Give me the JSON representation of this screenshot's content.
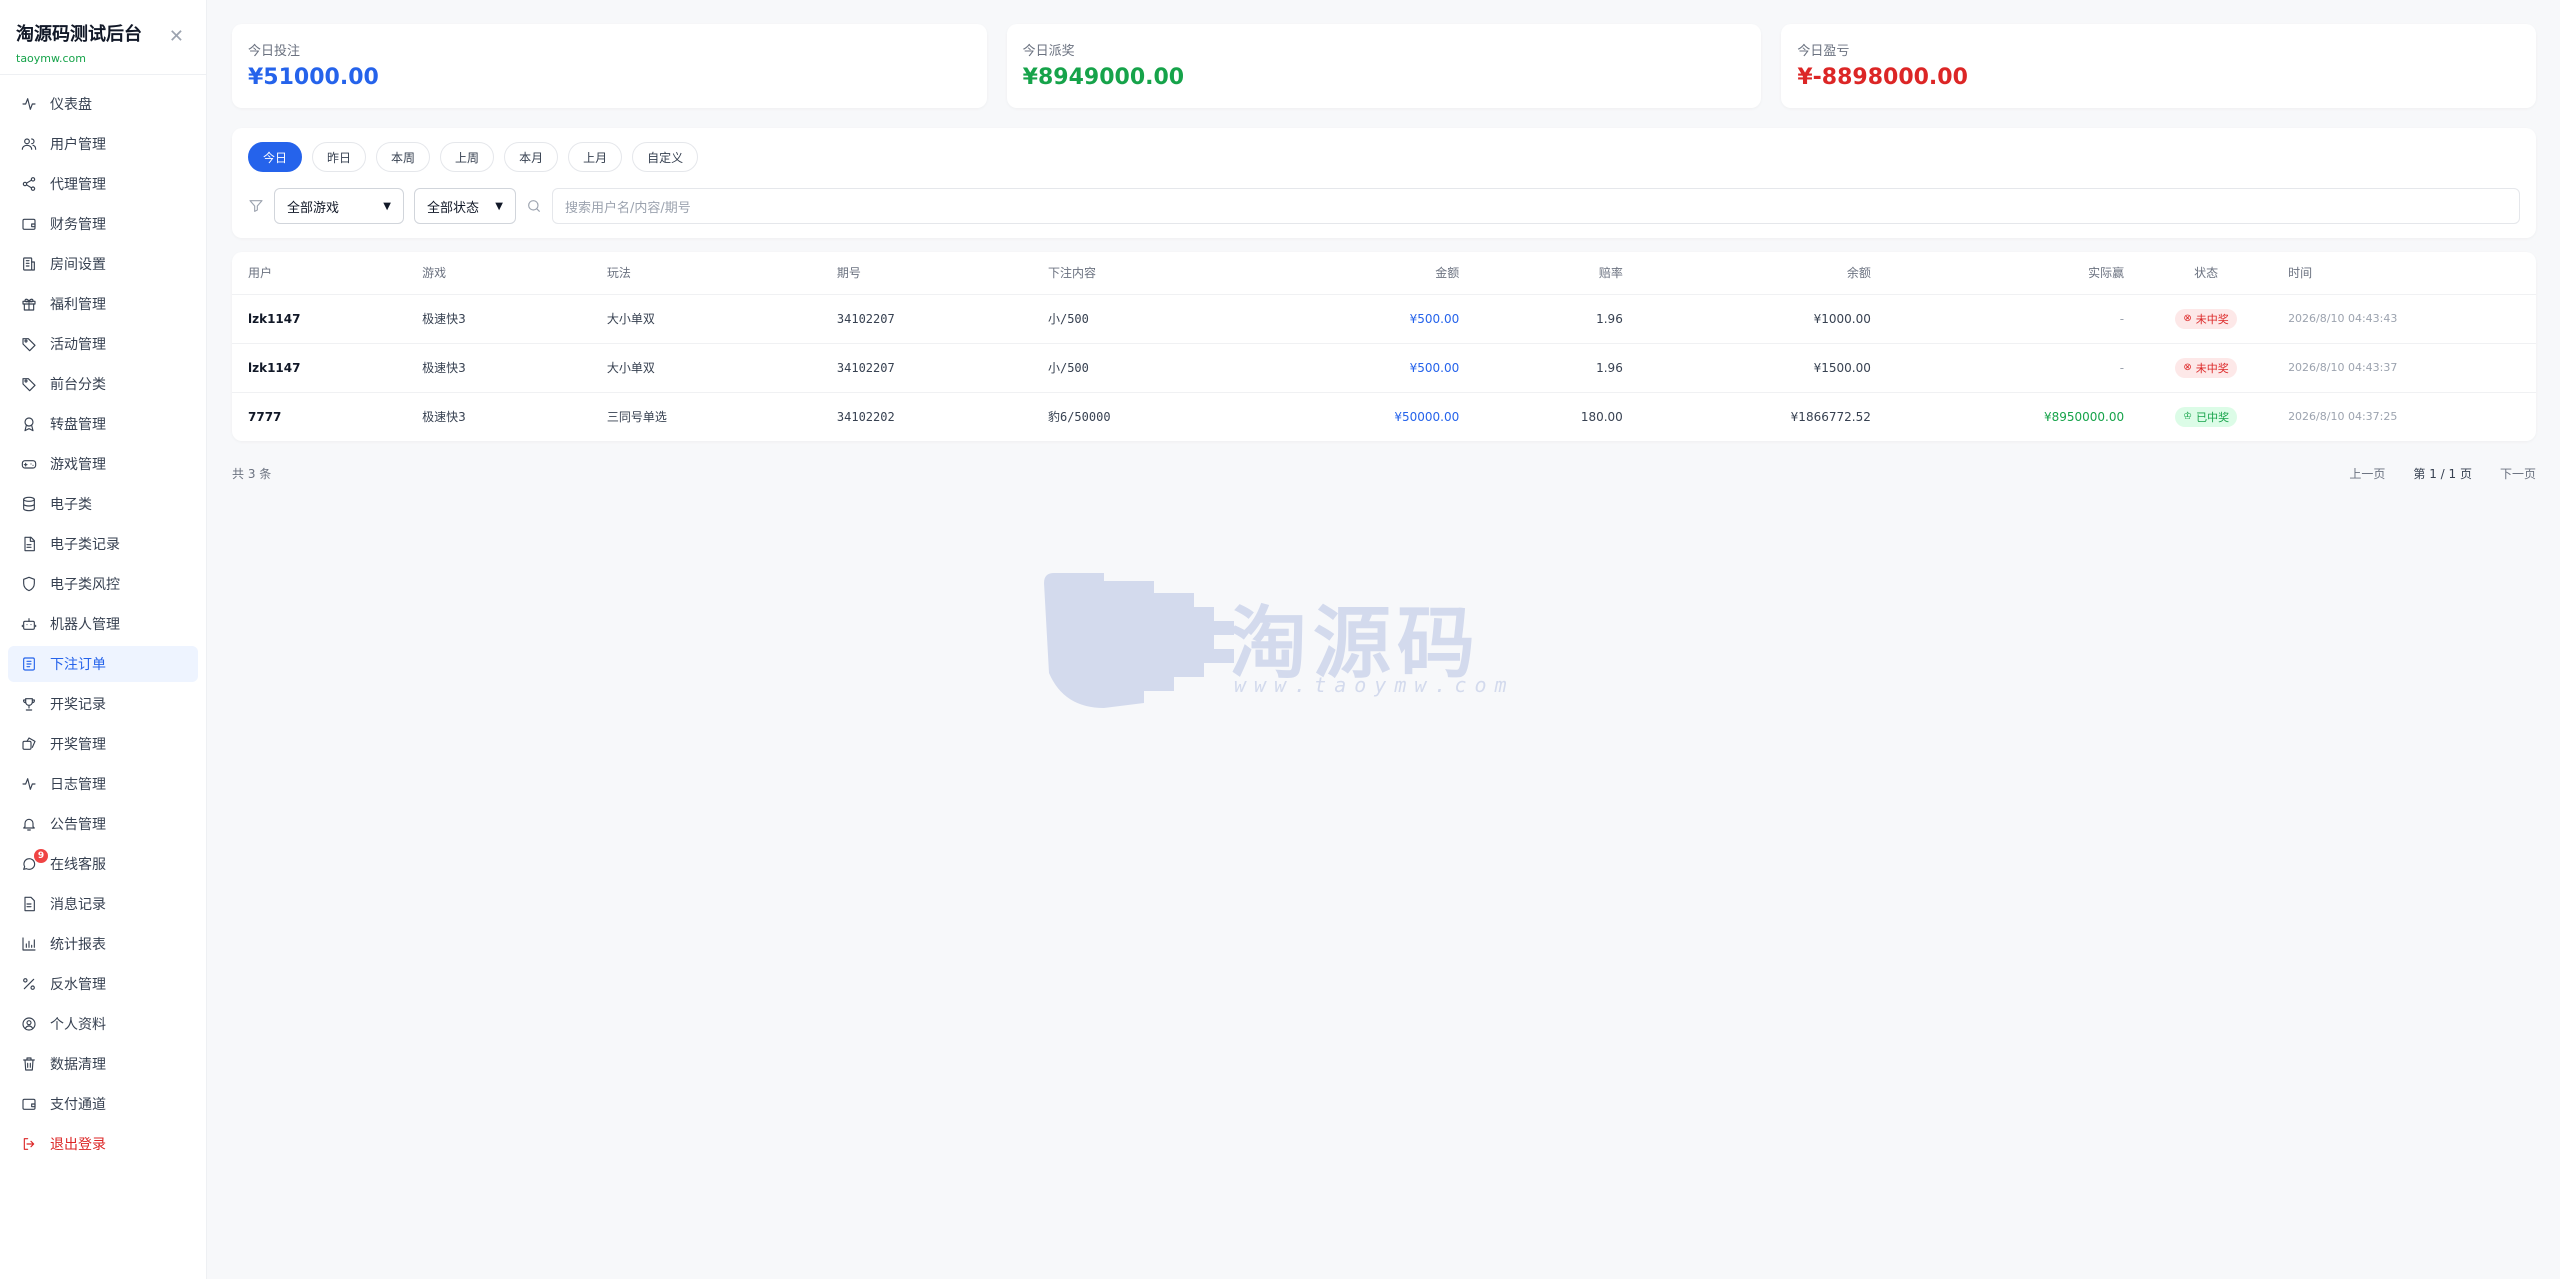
{
  "brand": {
    "title": "淘源码测试后台",
    "subtitle": "taoymw.com"
  },
  "nav": [
    {
      "label": "仪表盘",
      "icon": "activity-icon"
    },
    {
      "label": "用户管理",
      "icon": "users-icon"
    },
    {
      "label": "代理管理",
      "icon": "share-icon"
    },
    {
      "label": "财务管理",
      "icon": "wallet-icon"
    },
    {
      "label": "房间设置",
      "icon": "building-icon"
    },
    {
      "label": "福利管理",
      "icon": "gift-icon"
    },
    {
      "label": "活动管理",
      "icon": "tag-icon"
    },
    {
      "label": "前台分类",
      "icon": "tags-icon"
    },
    {
      "label": "转盘管理",
      "icon": "award-icon"
    },
    {
      "label": "游戏管理",
      "icon": "gamepad-icon"
    },
    {
      "label": "电子类",
      "icon": "database-icon"
    },
    {
      "label": "电子类记录",
      "icon": "file-icon"
    },
    {
      "label": "电子类风控",
      "icon": "shield-icon"
    },
    {
      "label": "机器人管理",
      "icon": "bot-icon"
    },
    {
      "label": "下注订单",
      "icon": "receipt-icon",
      "active": true
    },
    {
      "label": "开奖记录",
      "icon": "trophy-icon"
    },
    {
      "label": "开奖管理",
      "icon": "dice-icon"
    },
    {
      "label": "日志管理",
      "icon": "pulse-icon"
    },
    {
      "label": "公告管理",
      "icon": "bell-icon"
    },
    {
      "label": "在线客服",
      "icon": "chat-icon",
      "badge": "9"
    },
    {
      "label": "消息记录",
      "icon": "message-icon"
    },
    {
      "label": "统计报表",
      "icon": "chart-icon"
    },
    {
      "label": "反水管理",
      "icon": "percent-icon"
    },
    {
      "label": "个人资料",
      "icon": "user-circle-icon"
    },
    {
      "label": "数据清理",
      "icon": "trash-icon"
    },
    {
      "label": "支付通道",
      "icon": "card-icon"
    },
    {
      "label": "退出登录",
      "icon": "logout-icon",
      "logout": true
    }
  ],
  "stats": [
    {
      "label": "今日投注",
      "value": "¥51000.00",
      "color": "#2563eb"
    },
    {
      "label": "今日派奖",
      "value": "¥8949000.00",
      "color": "#16a34a"
    },
    {
      "label": "今日盈亏",
      "value": "¥-8898000.00",
      "color": "#dc2626"
    }
  ],
  "tabs": [
    "今日",
    "昨日",
    "本周",
    "上周",
    "本月",
    "上月",
    "自定义"
  ],
  "filters": {
    "game_select": "全部游戏",
    "status_select": "全部状态",
    "search_placeholder": "搜索用户名/内容/期号"
  },
  "table": {
    "headers": [
      "用户",
      "游戏",
      "玩法",
      "期号",
      "下注内容",
      "金额",
      "赔率",
      "余额",
      "实际赢",
      "状态",
      "时间"
    ],
    "rows": [
      {
        "user": "lzk1147",
        "game": "极速快3",
        "play": "大小单双",
        "period": "34102207",
        "content": "小/500",
        "amount": "¥500.00",
        "odds": "1.96",
        "balance": "¥1000.00",
        "payout": "-",
        "status": "未中奖",
        "win": false,
        "time": "2026/8/10 04:43:43"
      },
      {
        "user": "lzk1147",
        "game": "极速快3",
        "play": "大小单双",
        "period": "34102207",
        "content": "小/500",
        "amount": "¥500.00",
        "odds": "1.96",
        "balance": "¥1500.00",
        "payout": "-",
        "status": "未中奖",
        "win": false,
        "time": "2026/8/10 04:43:37"
      },
      {
        "user": "7777",
        "game": "极速快3",
        "play": "三同号单选",
        "period": "34102202",
        "content": "豹6/50000",
        "amount": "¥50000.00",
        "odds": "180.00",
        "balance": "¥1866772.52",
        "payout": "¥8950000.00",
        "status": "已中奖",
        "win": true,
        "time": "2026/8/10 04:37:25"
      }
    ]
  },
  "pager": {
    "total": "共 3 条",
    "prev": "上一页",
    "info": "第 1 / 1 页",
    "next": "下一页"
  },
  "watermark": {
    "text": "淘源码",
    "url": "www.taoymw.com"
  }
}
